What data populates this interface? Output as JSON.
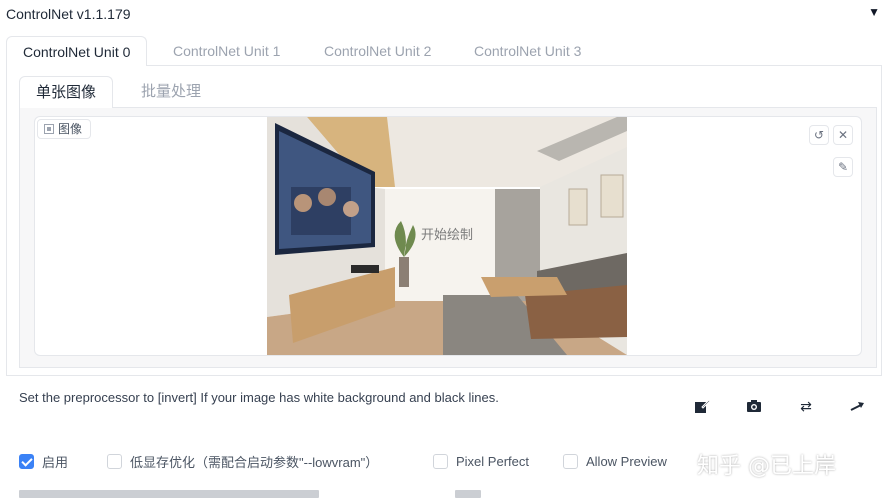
{
  "header": {
    "title": "ControlNet v1.1.179",
    "collapse_icon": "triangle-down-icon"
  },
  "unit_tabs": [
    {
      "label": "ControlNet Unit 0",
      "active": true
    },
    {
      "label": "ControlNet Unit 1",
      "active": false
    },
    {
      "label": "ControlNet Unit 2",
      "active": false
    },
    {
      "label": "ControlNet Unit 3",
      "active": false
    }
  ],
  "mode_tabs": [
    {
      "label": "单张图像",
      "active": true
    },
    {
      "label": "批量处理",
      "active": false
    }
  ],
  "image_input": {
    "label": "图像",
    "overlay_text": "开始绘制",
    "buttons": {
      "undo_icon": "undo-icon",
      "clear_icon": "close-icon",
      "brush_icon": "brush-icon"
    }
  },
  "hint": "Set the preprocessor to [invert] If your image has white background and black lines.",
  "tools": [
    "edit-canvas-icon",
    "camera-icon",
    "swap-icon",
    "send-dimensions-icon"
  ],
  "options": [
    {
      "label": "启用",
      "checked": true
    },
    {
      "label": "低显存优化（需配合启动参数\"--lowvram\"）",
      "checked": false
    },
    {
      "label": "Pixel Perfect",
      "checked": false
    },
    {
      "label": "Allow Preview",
      "checked": false
    }
  ],
  "watermark": "知乎 @已上岸",
  "colors": {
    "accent": "#3b82f6",
    "border": "#e5e7eb",
    "muted": "#9ca3af"
  }
}
